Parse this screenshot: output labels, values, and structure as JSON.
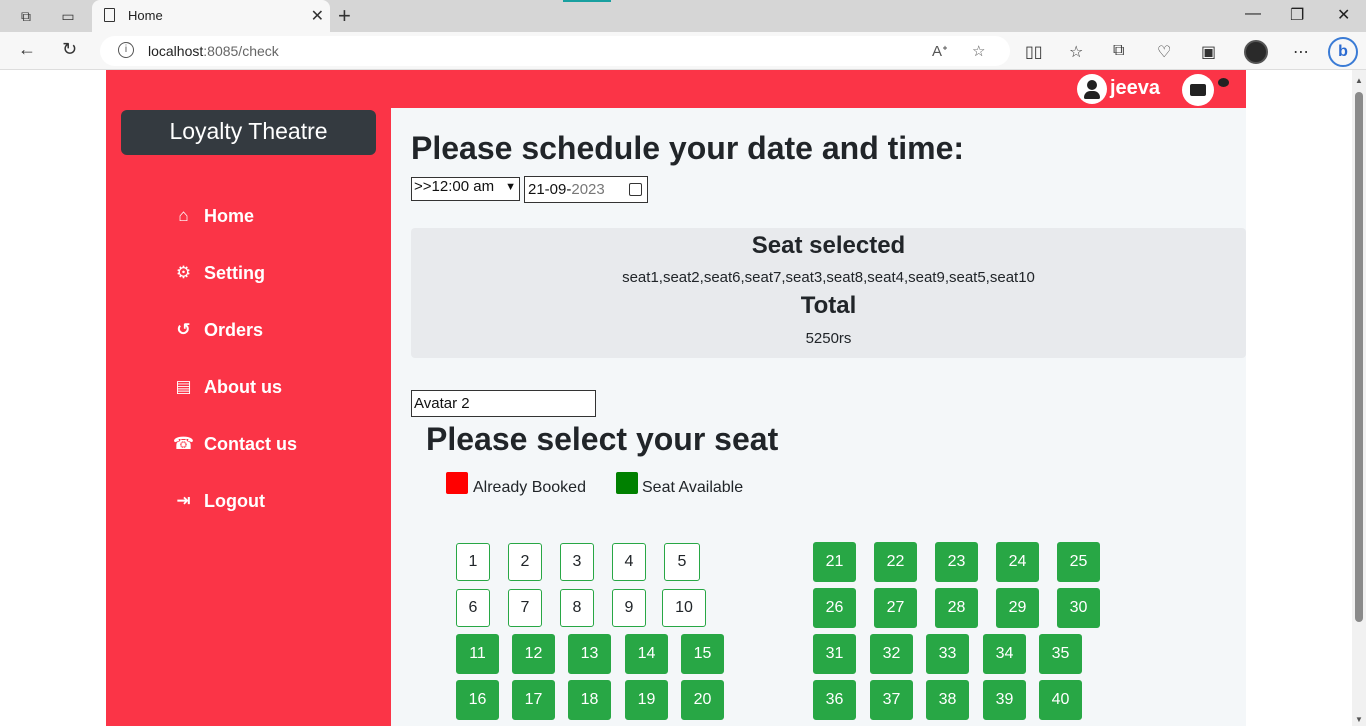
{
  "browser": {
    "tab_title": "Home",
    "url_host": "localhost:8085/check",
    "url_display_host": "localhost",
    "url_display_path": ":8085/check"
  },
  "header": {
    "username": "jeeva"
  },
  "sidebar": {
    "brand": "Loyalty Theatre",
    "items": [
      {
        "label": "Home",
        "icon": "home-icon"
      },
      {
        "label": "Setting",
        "icon": "gears-icon"
      },
      {
        "label": "Orders",
        "icon": "history-icon"
      },
      {
        "label": "About us",
        "icon": "id-card-icon"
      },
      {
        "label": "Contact us",
        "icon": "phone-square-icon"
      },
      {
        "label": "Logout",
        "icon": "sign-out-icon"
      }
    ]
  },
  "schedule": {
    "heading": "Please schedule your date and time:",
    "time_value": ">>12:00 am",
    "date_day_month": "21-09-",
    "date_year": "2023"
  },
  "summary": {
    "seat_heading": "Seat selected",
    "seats": "seat1,seat2,seat6,seat7,seat3,seat8,seat4,seat9,seat5,seat10",
    "total_heading": "Total",
    "total_value": "5250rs"
  },
  "movie": {
    "value": "Avatar 2"
  },
  "seat_section": {
    "heading": "Please select your seat",
    "legend_booked": "Already Booked",
    "legend_available": "Seat Available",
    "booked_color": "#ff0000",
    "available_color": "#008000"
  },
  "seats_left": [
    {
      "row": [
        "1",
        "2",
        "3",
        "4",
        "5"
      ],
      "state": "selected"
    },
    {
      "row": [
        "6",
        "7",
        "8",
        "9",
        "10"
      ],
      "state": "selected"
    },
    {
      "row": [
        "11",
        "12",
        "13",
        "14",
        "15"
      ],
      "state": "available"
    },
    {
      "row": [
        "16",
        "17",
        "18",
        "19",
        "20"
      ],
      "state": "available"
    }
  ],
  "seats_right": [
    {
      "row": [
        "21",
        "22",
        "23",
        "24",
        "25"
      ],
      "state": "available"
    },
    {
      "row": [
        "26",
        "27",
        "28",
        "29",
        "30"
      ],
      "state": "available"
    },
    {
      "row": [
        "31",
        "32",
        "33",
        "34",
        "35"
      ],
      "state": "available"
    },
    {
      "row": [
        "36",
        "37",
        "38",
        "39",
        "40"
      ],
      "state": "available"
    }
  ],
  "colors": {
    "brand_red": "#fb3447",
    "brand_dark": "#343a40",
    "seat_green": "#28a745"
  }
}
